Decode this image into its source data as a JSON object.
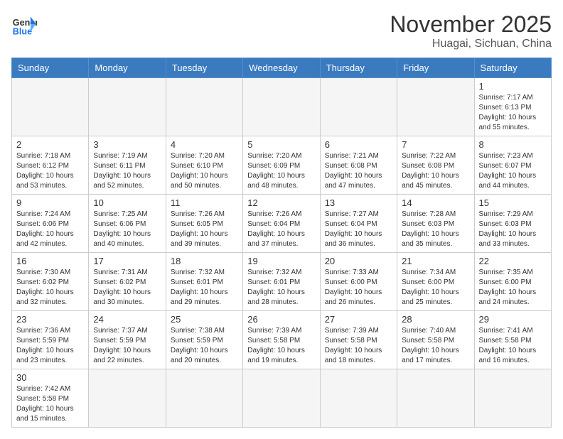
{
  "header": {
    "logo_general": "General",
    "logo_blue": "Blue",
    "month_title": "November 2025",
    "location": "Huagai, Sichuan, China"
  },
  "weekdays": [
    "Sunday",
    "Monday",
    "Tuesday",
    "Wednesday",
    "Thursday",
    "Friday",
    "Saturday"
  ],
  "weeks": [
    [
      {
        "day": "",
        "info": ""
      },
      {
        "day": "",
        "info": ""
      },
      {
        "day": "",
        "info": ""
      },
      {
        "day": "",
        "info": ""
      },
      {
        "day": "",
        "info": ""
      },
      {
        "day": "",
        "info": ""
      },
      {
        "day": "1",
        "info": "Sunrise: 7:17 AM\nSunset: 6:13 PM\nDaylight: 10 hours\nand 55 minutes."
      }
    ],
    [
      {
        "day": "2",
        "info": "Sunrise: 7:18 AM\nSunset: 6:12 PM\nDaylight: 10 hours\nand 53 minutes."
      },
      {
        "day": "3",
        "info": "Sunrise: 7:19 AM\nSunset: 6:11 PM\nDaylight: 10 hours\nand 52 minutes."
      },
      {
        "day": "4",
        "info": "Sunrise: 7:20 AM\nSunset: 6:10 PM\nDaylight: 10 hours\nand 50 minutes."
      },
      {
        "day": "5",
        "info": "Sunrise: 7:20 AM\nSunset: 6:09 PM\nDaylight: 10 hours\nand 48 minutes."
      },
      {
        "day": "6",
        "info": "Sunrise: 7:21 AM\nSunset: 6:08 PM\nDaylight: 10 hours\nand 47 minutes."
      },
      {
        "day": "7",
        "info": "Sunrise: 7:22 AM\nSunset: 6:08 PM\nDaylight: 10 hours\nand 45 minutes."
      },
      {
        "day": "8",
        "info": "Sunrise: 7:23 AM\nSunset: 6:07 PM\nDaylight: 10 hours\nand 44 minutes."
      }
    ],
    [
      {
        "day": "9",
        "info": "Sunrise: 7:24 AM\nSunset: 6:06 PM\nDaylight: 10 hours\nand 42 minutes."
      },
      {
        "day": "10",
        "info": "Sunrise: 7:25 AM\nSunset: 6:06 PM\nDaylight: 10 hours\nand 40 minutes."
      },
      {
        "day": "11",
        "info": "Sunrise: 7:26 AM\nSunset: 6:05 PM\nDaylight: 10 hours\nand 39 minutes."
      },
      {
        "day": "12",
        "info": "Sunrise: 7:26 AM\nSunset: 6:04 PM\nDaylight: 10 hours\nand 37 minutes."
      },
      {
        "day": "13",
        "info": "Sunrise: 7:27 AM\nSunset: 6:04 PM\nDaylight: 10 hours\nand 36 minutes."
      },
      {
        "day": "14",
        "info": "Sunrise: 7:28 AM\nSunset: 6:03 PM\nDaylight: 10 hours\nand 35 minutes."
      },
      {
        "day": "15",
        "info": "Sunrise: 7:29 AM\nSunset: 6:03 PM\nDaylight: 10 hours\nand 33 minutes."
      }
    ],
    [
      {
        "day": "16",
        "info": "Sunrise: 7:30 AM\nSunset: 6:02 PM\nDaylight: 10 hours\nand 32 minutes."
      },
      {
        "day": "17",
        "info": "Sunrise: 7:31 AM\nSunset: 6:02 PM\nDaylight: 10 hours\nand 30 minutes."
      },
      {
        "day": "18",
        "info": "Sunrise: 7:32 AM\nSunset: 6:01 PM\nDaylight: 10 hours\nand 29 minutes."
      },
      {
        "day": "19",
        "info": "Sunrise: 7:32 AM\nSunset: 6:01 PM\nDaylight: 10 hours\nand 28 minutes."
      },
      {
        "day": "20",
        "info": "Sunrise: 7:33 AM\nSunset: 6:00 PM\nDaylight: 10 hours\nand 26 minutes."
      },
      {
        "day": "21",
        "info": "Sunrise: 7:34 AM\nSunset: 6:00 PM\nDaylight: 10 hours\nand 25 minutes."
      },
      {
        "day": "22",
        "info": "Sunrise: 7:35 AM\nSunset: 6:00 PM\nDaylight: 10 hours\nand 24 minutes."
      }
    ],
    [
      {
        "day": "23",
        "info": "Sunrise: 7:36 AM\nSunset: 5:59 PM\nDaylight: 10 hours\nand 23 minutes."
      },
      {
        "day": "24",
        "info": "Sunrise: 7:37 AM\nSunset: 5:59 PM\nDaylight: 10 hours\nand 22 minutes."
      },
      {
        "day": "25",
        "info": "Sunrise: 7:38 AM\nSunset: 5:59 PM\nDaylight: 10 hours\nand 20 minutes."
      },
      {
        "day": "26",
        "info": "Sunrise: 7:39 AM\nSunset: 5:58 PM\nDaylight: 10 hours\nand 19 minutes."
      },
      {
        "day": "27",
        "info": "Sunrise: 7:39 AM\nSunset: 5:58 PM\nDaylight: 10 hours\nand 18 minutes."
      },
      {
        "day": "28",
        "info": "Sunrise: 7:40 AM\nSunset: 5:58 PM\nDaylight: 10 hours\nand 17 minutes."
      },
      {
        "day": "29",
        "info": "Sunrise: 7:41 AM\nSunset: 5:58 PM\nDaylight: 10 hours\nand 16 minutes."
      }
    ],
    [
      {
        "day": "30",
        "info": "Sunrise: 7:42 AM\nSunset: 5:58 PM\nDaylight: 10 hours\nand 15 minutes."
      },
      {
        "day": "",
        "info": ""
      },
      {
        "day": "",
        "info": ""
      },
      {
        "day": "",
        "info": ""
      },
      {
        "day": "",
        "info": ""
      },
      {
        "day": "",
        "info": ""
      },
      {
        "day": "",
        "info": ""
      }
    ]
  ]
}
